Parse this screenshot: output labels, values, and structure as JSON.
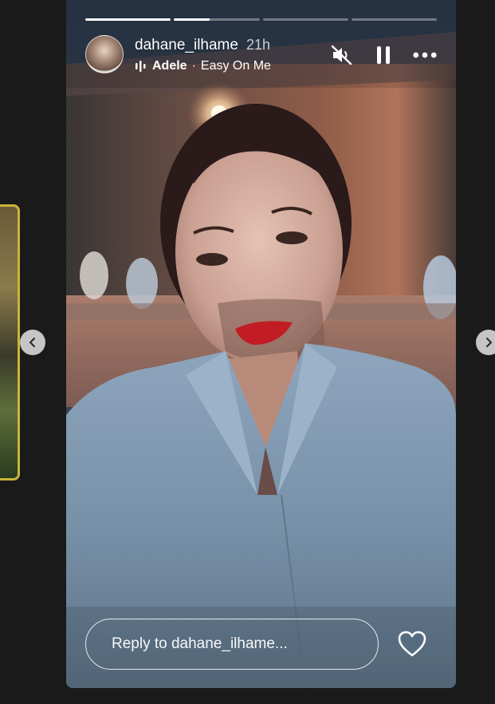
{
  "story": {
    "username": "dahane_ilhame",
    "time_ago": "21h",
    "music": {
      "artist": "Adele",
      "separator": "·",
      "song": "Easy On Me"
    },
    "progress": [
      1.0,
      0.42,
      0.0,
      0.0
    ]
  },
  "reply": {
    "placeholder": "Reply to dahane_ilhame..."
  },
  "icons": {
    "mute": "speaker-muted-icon",
    "pause": "pause-icon",
    "more": "more-horizontal-icon",
    "like": "heart-icon",
    "prev": "chevron-left-icon",
    "next": "chevron-right-icon",
    "music": "audio-bars-icon"
  }
}
